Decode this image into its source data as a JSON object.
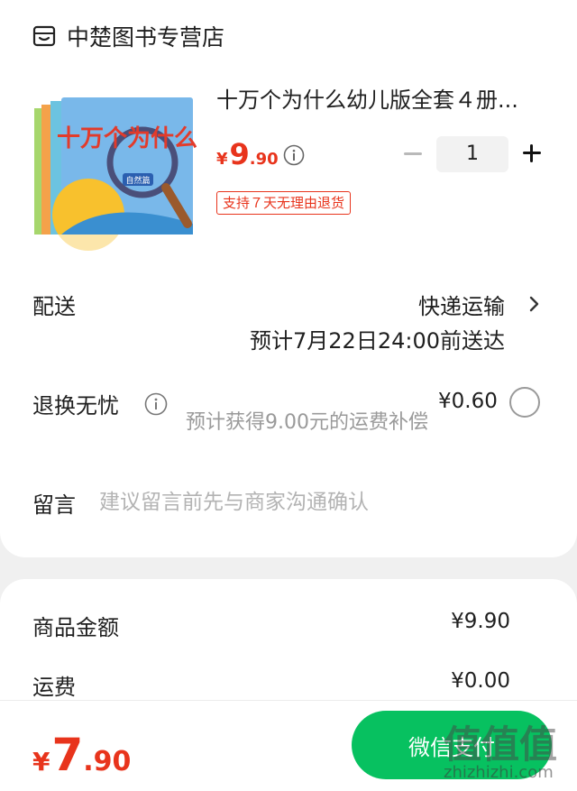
{
  "store": {
    "name": "中楚图书专营店",
    "icon": "store-icon"
  },
  "product": {
    "title": "十万个为什么幼儿版全套４册...",
    "cover_text": "十万个为什么",
    "cover_tag": "自然篇",
    "price_symbol": "¥",
    "price_int": "9",
    "price_dec": ".90",
    "quantity": "1",
    "return_badge": "支持７天无理由退货"
  },
  "delivery": {
    "label": "配送",
    "method": "快递运输",
    "eta": "预计7月22日24:00前送达"
  },
  "return_insurance": {
    "label": "退换无忧",
    "hint": "预计获得9.00元的运费补偿",
    "price": "¥0.60",
    "selected": false
  },
  "message": {
    "label": "留言",
    "placeholder": "建议留言前先与商家沟通确认"
  },
  "summary": {
    "goods_label": "商品金额",
    "goods_value": "¥9.90",
    "shipping_label": "运费",
    "shipping_value": "¥0.00"
  },
  "footer": {
    "total_symbol": "¥",
    "total_int": "7",
    "total_dec": ".90",
    "pay_label": "微信支付"
  },
  "watermark": {
    "text": "zhizhizhi.com",
    "logo_chars": "值值值"
  },
  "colors": {
    "accent": "#e8341c",
    "pay_green": "#07c160"
  }
}
